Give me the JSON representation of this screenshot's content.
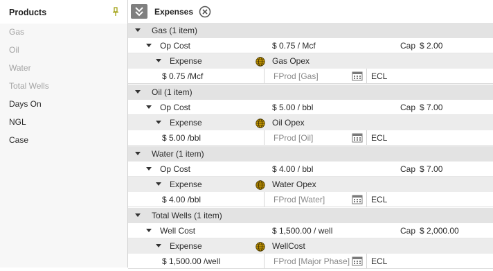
{
  "left_panel": {
    "title": "Products",
    "items": [
      {
        "label": "Gas",
        "enabled": false
      },
      {
        "label": "Oil",
        "enabled": false
      },
      {
        "label": "Water",
        "enabled": false
      },
      {
        "label": "Total Wells",
        "enabled": false
      },
      {
        "label": "Days On",
        "enabled": true
      },
      {
        "label": "NGL",
        "enabled": true
      },
      {
        "label": "Case",
        "enabled": true
      }
    ]
  },
  "right_panel": {
    "title": "Expenses",
    "groups": [
      {
        "label": "Gas (1 item)",
        "cost_label": "Op Cost",
        "cost_value": "$ 0.75 / Mcf",
        "cap_label": "Cap",
        "cap_value": "$ 2.00",
        "expense_label": "Expense",
        "expense_name": "Gas Opex",
        "rate": "$ 0.75 /Mcf",
        "formula": "FProd [Gas]",
        "method": "ECL"
      },
      {
        "label": "Oil (1 item)",
        "cost_label": "Op Cost",
        "cost_value": "$ 5.00 / bbl",
        "cap_label": "Cap",
        "cap_value": "$ 7.00",
        "expense_label": "Expense",
        "expense_name": "Oil Opex",
        "rate": "$ 5.00 /bbl",
        "formula": "FProd [Oil]",
        "method": "ECL"
      },
      {
        "label": "Water (1 item)",
        "cost_label": "Op Cost",
        "cost_value": "$ 4.00 / bbl",
        "cap_label": "Cap",
        "cap_value": "$ 7.00",
        "expense_label": "Expense",
        "expense_name": "Water Opex",
        "rate": "$ 4.00 /bbl",
        "formula": "FProd [Water]",
        "method": "ECL"
      },
      {
        "label": "Total Wells (1 item)",
        "cost_label": "Well Cost",
        "cost_value": "$ 1,500.00 / well",
        "cap_label": "Cap",
        "cap_value": "$ 2,000.00",
        "expense_label": "Expense",
        "expense_name": "WellCost",
        "rate": "$ 1,500.00 /well",
        "formula": "FProd [Major Phase]",
        "method": "ECL"
      }
    ]
  },
  "icons": {
    "pin": "pin-icon",
    "collapse": "double-chevron-down-icon",
    "close": "close-circle-icon",
    "expense_type": "globe-icon",
    "date_picker": "calendar-icon",
    "expand": "triangle-down-icon"
  },
  "colors": {
    "group_row": "#e3e3e3",
    "expense_row": "#ececec",
    "disabled_text": "#a4a4a4",
    "globe": "#b58a00"
  }
}
